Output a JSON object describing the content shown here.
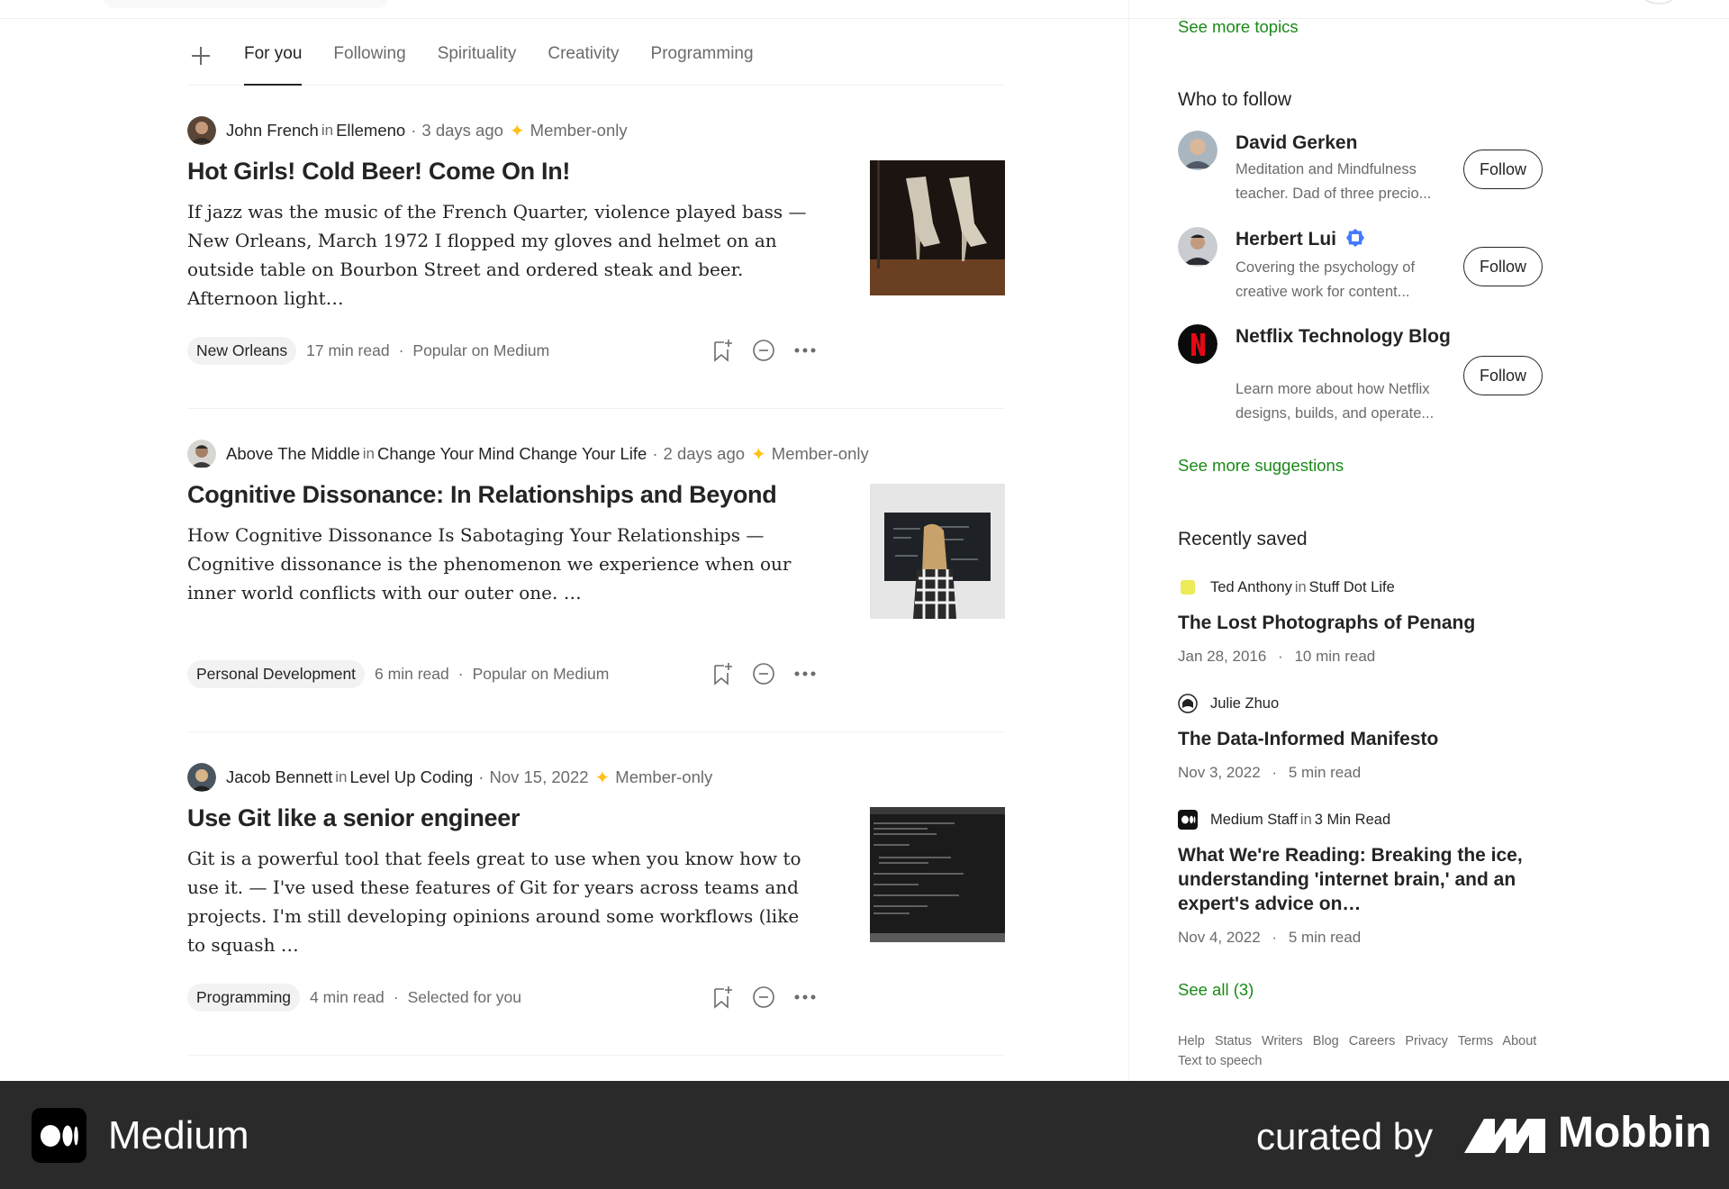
{
  "header": {
    "tabs": [
      "For you",
      "Following",
      "Spirituality",
      "Creativity",
      "Programming"
    ]
  },
  "articles": [
    {
      "author": "John French",
      "in_label": "in",
      "publication": "Ellemeno",
      "date": "3 days ago",
      "member": "Member-only",
      "title": "Hot Girls! Cold Beer! Come On In!",
      "snippet": "If jazz was the music of the French Quarter, violence played bass — New Orleans, March 1972 I flopped my gloves and helmet on an outside table on Bourbon Street and ordered steak and beer. Afternoon light…",
      "tag": "New Orleans",
      "read_time": "17 min read",
      "reason": "Popular on Medium"
    },
    {
      "author": "Above The Middle",
      "in_label": "in",
      "publication": "Change Your Mind Change Your Life",
      "date": "2 days ago",
      "member": "Member-only",
      "title": "Cognitive Dissonance: In Relationships and Beyond",
      "snippet": "How Cognitive Dissonance Is Sabotaging Your Relationships — Cognitive dissonance is the phenomenon we experience when our inner world conflicts with our outer one. …",
      "tag": "Personal Development",
      "read_time": "6 min read",
      "reason": "Popular on Medium"
    },
    {
      "author": "Jacob Bennett",
      "in_label": "in",
      "publication": "Level Up Coding",
      "date": "Nov 15, 2022",
      "member": "Member-only",
      "title": "Use Git like a senior engineer",
      "snippet": "Git is a powerful tool that feels great to use when you know how to use it. — I've used these features of Git for years across teams and projects. I'm still developing opinions around some workflows (like to squash …",
      "tag": "Programming",
      "read_time": "4 min read",
      "reason": "Selected for you"
    }
  ],
  "sidebar": {
    "see_more_topics": "See more topics",
    "who_to_follow": "Who to follow",
    "follow_label": "Follow",
    "people": [
      {
        "name": "David Gerken",
        "desc": "Meditation and Mindfulness teacher. Dad of three precio..."
      },
      {
        "name": "Herbert Lui",
        "desc": "Covering the psychology of creative work for content..."
      },
      {
        "name": "Netflix Technology Blog",
        "desc": "Learn more about how Netflix designs, builds, and operate..."
      }
    ],
    "see_more_suggestions": "See more suggestions",
    "recently_saved": "Recently saved",
    "saved": [
      {
        "author": "Ted Anthony",
        "in_label": "in",
        "publication": "Stuff Dot Life",
        "title": "The Lost Photographs of Penang",
        "date": "Jan 28, 2016",
        "read_time": "10 min read"
      },
      {
        "author": "Julie Zhuo",
        "in_label": "",
        "publication": "",
        "title": "The Data-Informed Manifesto",
        "date": "Nov 3, 2022",
        "read_time": "5 min read"
      },
      {
        "author": "Medium Staff",
        "in_label": "in",
        "publication": "3 Min Read",
        "title": "What We're Reading: Breaking the ice, understanding 'internet brain,' and an expert's advice on…",
        "date": "Nov 4, 2022",
        "read_time": "5 min read"
      }
    ],
    "see_all": "See all (3)",
    "footer_links": [
      "Help",
      "Status",
      "Writers",
      "Blog",
      "Careers",
      "Privacy",
      "Terms",
      "About"
    ],
    "footer_extra": "Text to speech"
  },
  "banner": {
    "app_name": "Medium",
    "curated_by": "curated by",
    "brand": "Mobbin"
  },
  "colors": {
    "accent_green": "#1a8917",
    "star": "#ffc017",
    "banner_bg": "#2a2a2a"
  }
}
